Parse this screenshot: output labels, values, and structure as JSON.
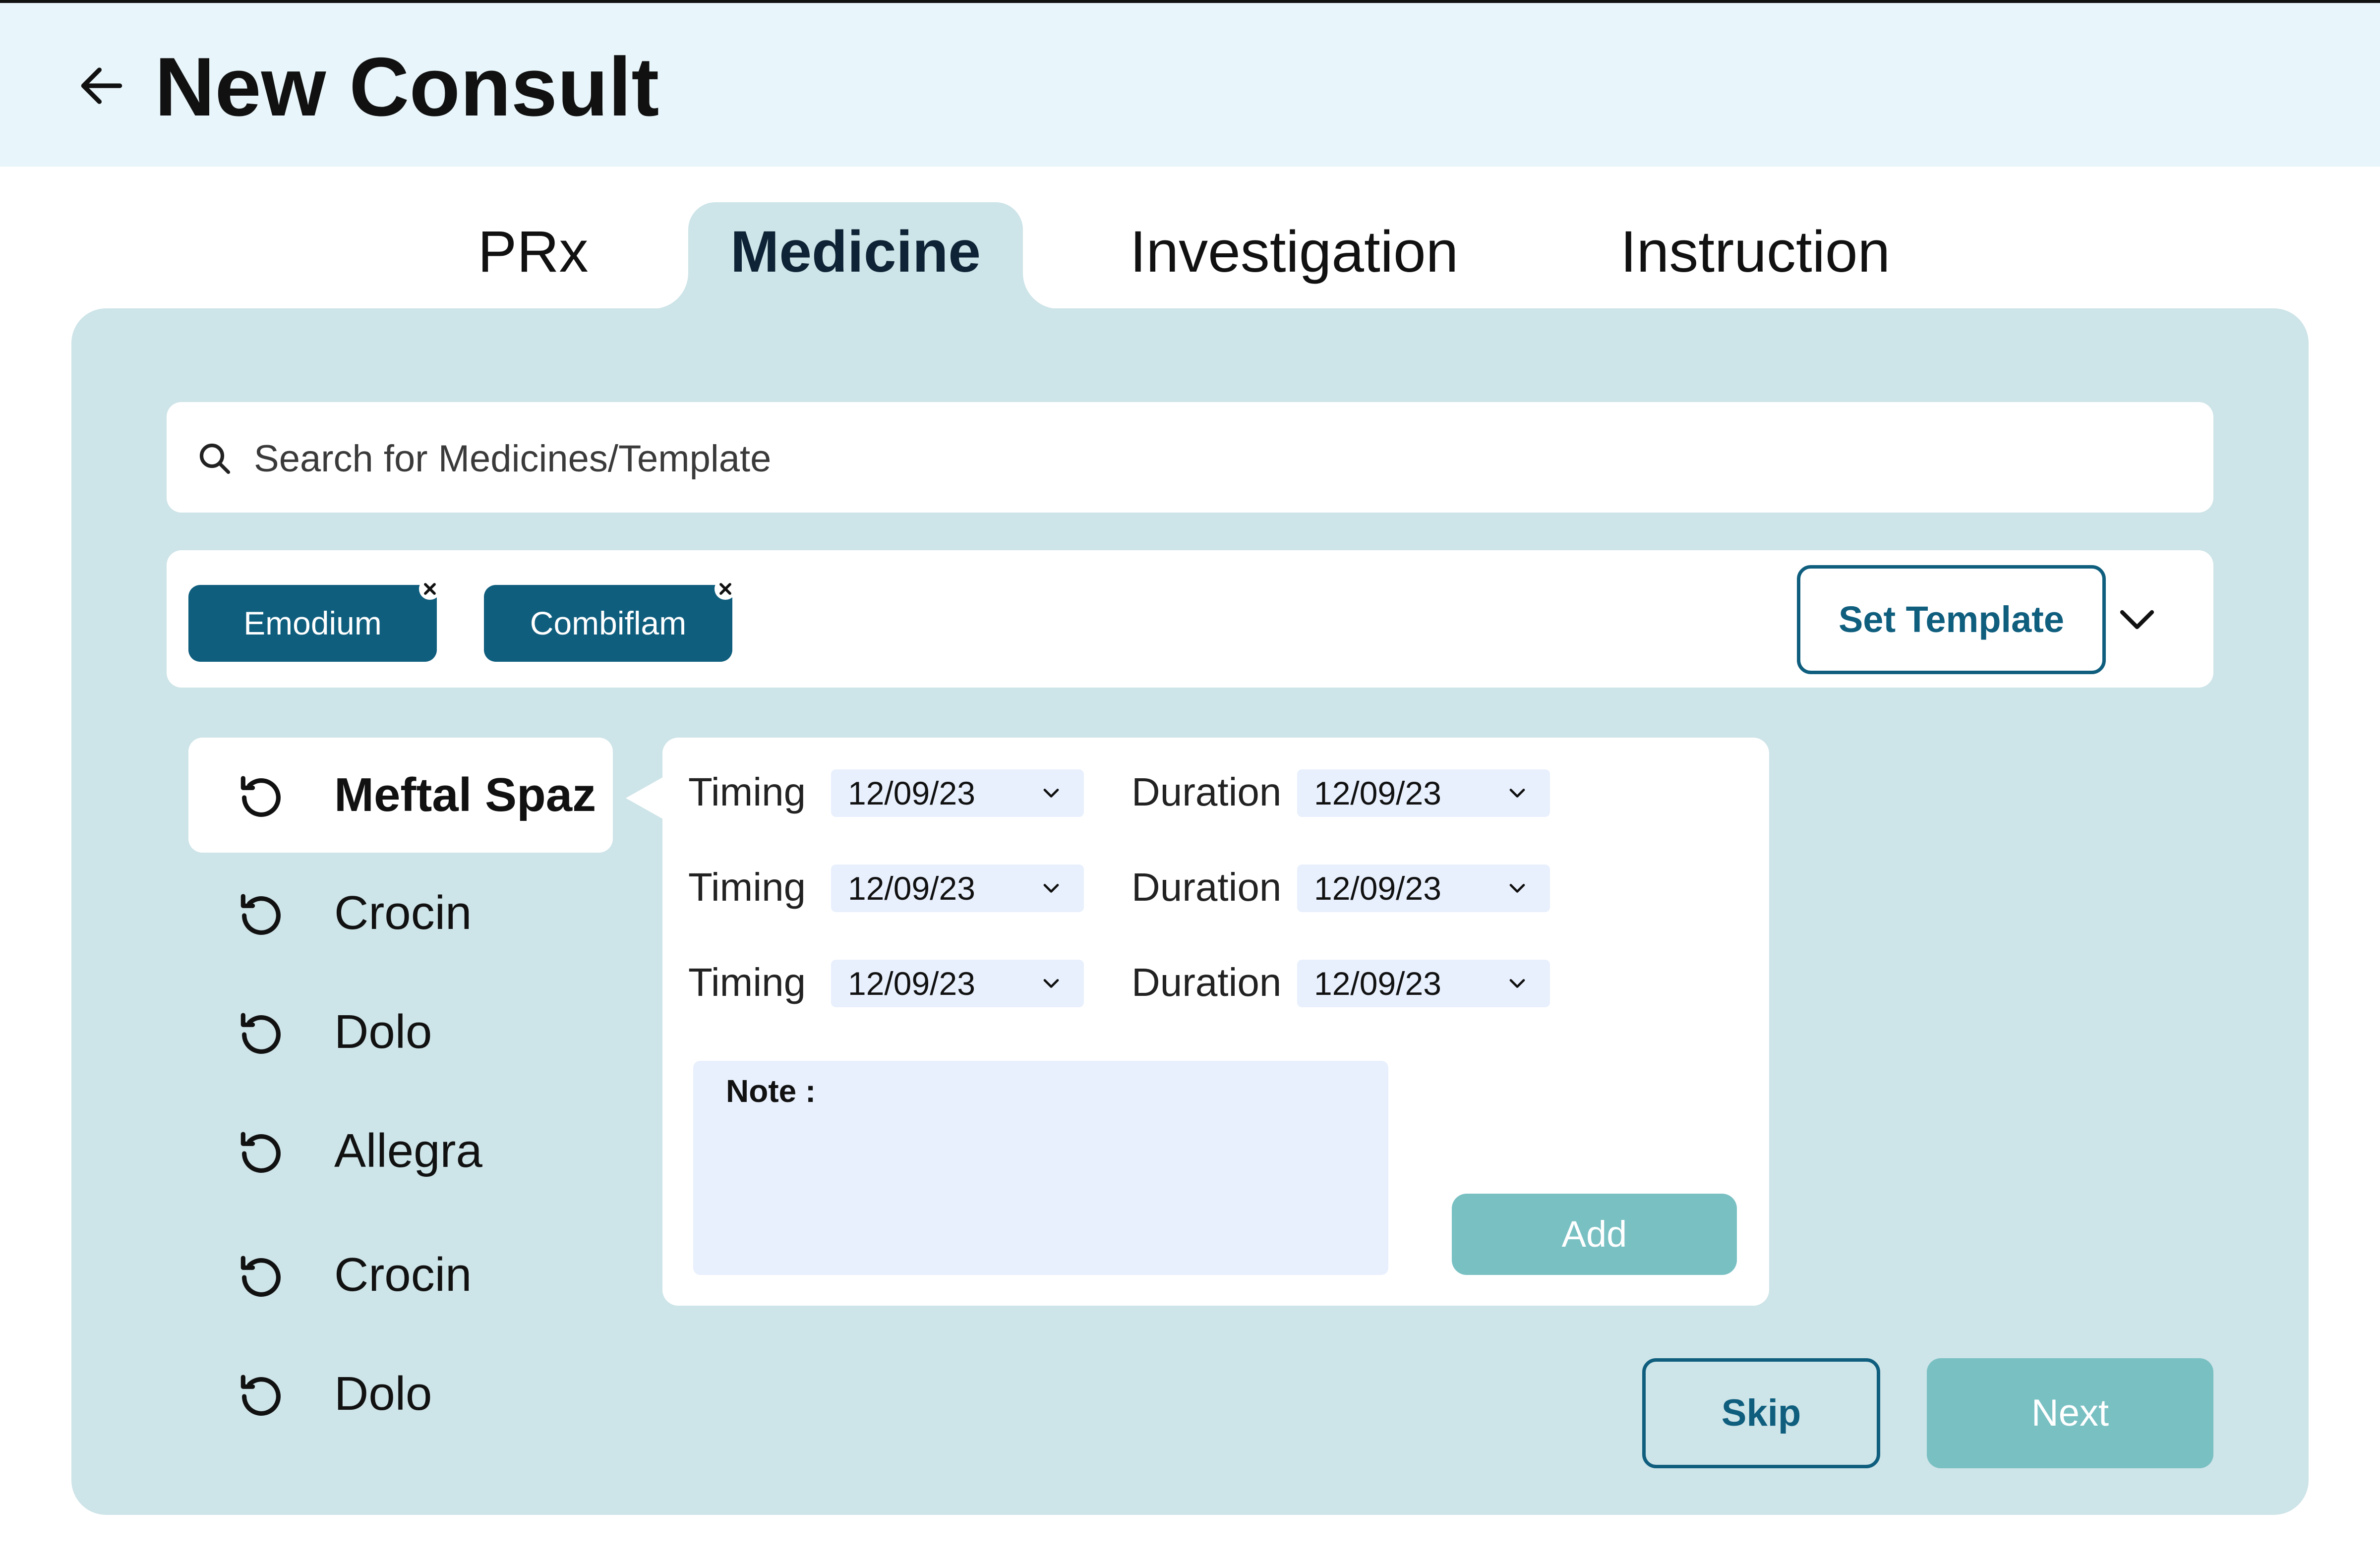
{
  "header": {
    "title": "New Consult",
    "back_icon": "arrow-left-icon"
  },
  "tabs": [
    {
      "label": "PRx",
      "active": false
    },
    {
      "label": "Medicine",
      "active": true
    },
    {
      "label": "Investigation",
      "active": false
    },
    {
      "label": "Instruction",
      "active": false
    }
  ],
  "search": {
    "placeholder": "Search for Medicines/Template",
    "icon": "search-icon"
  },
  "chips": [
    {
      "label": "Emodium",
      "remove_icon": "close-icon"
    },
    {
      "label": "Combiflam",
      "remove_icon": "close-icon"
    }
  ],
  "template": {
    "set_label": "Set Template",
    "dropdown_icon": "chevron-down-icon"
  },
  "medicine_list": [
    {
      "label": "Meftal Spaz",
      "selected": true,
      "icon": "history-icon"
    },
    {
      "label": "Crocin",
      "selected": false,
      "icon": "history-icon"
    },
    {
      "label": "Dolo",
      "selected": false,
      "icon": "history-icon"
    },
    {
      "label": "Allegra",
      "selected": false,
      "icon": "history-icon"
    },
    {
      "label": "Crocin",
      "selected": false,
      "icon": "history-icon"
    },
    {
      "label": "Dolo",
      "selected": false,
      "icon": "history-icon"
    }
  ],
  "dosage_rows": [
    {
      "timing_label": "Timing",
      "timing_value": "12/09/23",
      "duration_label": "Duration",
      "duration_value": "12/09/23"
    },
    {
      "timing_label": "Timing",
      "timing_value": "12/09/23",
      "duration_label": "Duration",
      "duration_value": "12/09/23"
    },
    {
      "timing_label": "Timing",
      "timing_value": "12/09/23",
      "duration_label": "Duration",
      "duration_value": "12/09/23"
    }
  ],
  "note": {
    "label": "Note :",
    "value": ""
  },
  "actions": {
    "add_label": "Add",
    "skip_label": "Skip",
    "next_label": "Next"
  },
  "colors": {
    "header_bg": "#e8f5fa",
    "panel_bg": "#cde4e8",
    "primary": "#0f5e7e",
    "accent": "#79c0c3",
    "field_bg": "#e8f0fd"
  }
}
